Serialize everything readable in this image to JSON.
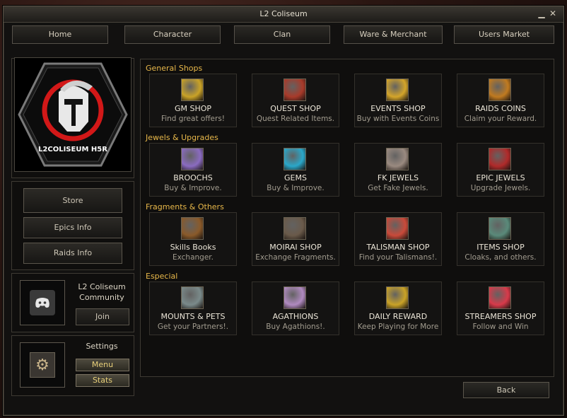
{
  "window": {
    "title": "L2 Coliseum"
  },
  "titlebar": {
    "minimize_glyph": "▁",
    "close_glyph": "✕"
  },
  "nav": [
    "Home",
    "Character",
    "Clan",
    "Ware & Merchant",
    "Users Market"
  ],
  "logo": {
    "text": "L2COLISEUM H5R"
  },
  "sidebar": {
    "buttons": [
      "Store",
      "Epics Info",
      "Raids Info"
    ]
  },
  "community": {
    "title": "L2 Coliseum Community",
    "join_label": "Join"
  },
  "settings": {
    "title": "Settings",
    "menu_label": "Menu",
    "stats_label": "Stats"
  },
  "sections": [
    {
      "title": "General Shops",
      "items": [
        {
          "name": "GM SHOP",
          "desc": "Find great offers!",
          "icon": "gold-coins-icon",
          "color": "#c9a227"
        },
        {
          "name": "QUEST SHOP",
          "desc": "Quest Related Items.",
          "icon": "quest-scroll-icon",
          "color": "#a83a2a"
        },
        {
          "name": "EVENTS SHOP",
          "desc": "Buy with Events Coins",
          "icon": "event-coin-icon",
          "color": "#d4a52a"
        },
        {
          "name": "RAIDS COINS",
          "desc": "Claim your Reward.",
          "icon": "raid-coin-icon",
          "color": "#c07a20"
        }
      ]
    },
    {
      "title": "Jewels & Upgrades",
      "items": [
        {
          "name": "BROOCHS",
          "desc": "Buy & Improve.",
          "icon": "brooch-icon",
          "color": "#8a6bc0"
        },
        {
          "name": "GEMS",
          "desc": "Buy & Improve.",
          "icon": "gem-icon",
          "color": "#2aa7c9"
        },
        {
          "name": "FK JEWELS",
          "desc": "Get Fake Jewels.",
          "icon": "fake-jewel-icon",
          "color": "#9a8a80"
        },
        {
          "name": "EPIC JEWELS",
          "desc": "Upgrade Jewels.",
          "icon": "epic-jewel-icon",
          "color": "#b02a2a"
        }
      ]
    },
    {
      "title": "Fragments & Others",
      "items": [
        {
          "name": "Skills Books",
          "desc": "Exchanger.",
          "icon": "book-icon",
          "color": "#8a5a2a"
        },
        {
          "name": "MOIRAI SHOP",
          "desc": "Exchange Fragments.",
          "icon": "armor-piece-icon",
          "color": "#6a5a4a"
        },
        {
          "name": "TALISMAN SHOP",
          "desc": "Find your Talismans!.",
          "icon": "talisman-icon",
          "color": "#c94a3a"
        },
        {
          "name": "ITEMS SHOP",
          "desc": "Cloaks, and others.",
          "icon": "cloak-icon",
          "color": "#5a8a7a"
        }
      ]
    },
    {
      "title": "Especial",
      "items": [
        {
          "name": "MOUNTS & PETS",
          "desc": "Get your Partners!.",
          "icon": "mount-icon",
          "color": "#7a8a8a"
        },
        {
          "name": "AGATHIONS",
          "desc": "Buy Agathions!.",
          "icon": "agathion-icon",
          "color": "#b08ac0"
        },
        {
          "name": "DAILY REWARD",
          "desc": "Keep Playing for More",
          "icon": "daily-reward-icon",
          "color": "#c9a227"
        },
        {
          "name": "STREAMERS SHOP",
          "desc": "Follow and Win",
          "icon": "heart-icon",
          "color": "#d83a4a"
        }
      ]
    }
  ],
  "footer": {
    "back_label": "Back"
  }
}
